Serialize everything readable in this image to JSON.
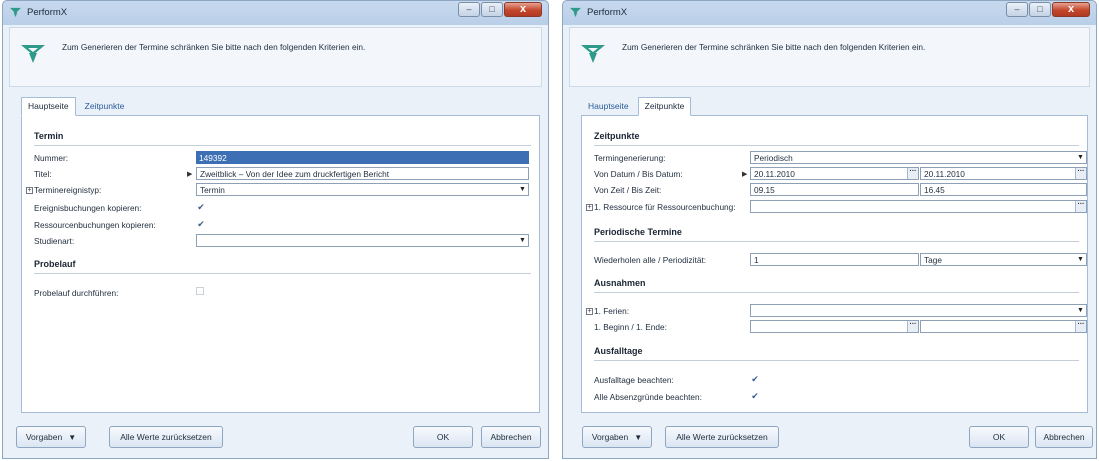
{
  "app": {
    "title": "PerformX",
    "header_text": "Zum Generieren der Termine schränken Sie bitte nach den folgenden Kriterien ein."
  },
  "window_controls": {
    "minimize": "–",
    "maximize": "□",
    "close": "x"
  },
  "tabs": {
    "main": "Hauptseite",
    "times": "Zeitpunkte"
  },
  "footer": {
    "presets": "Vorgaben",
    "reset_all": "Alle Werte zurücksetzen",
    "ok": "OK",
    "cancel": "Abbrechen"
  },
  "left": {
    "section_termin": "Termin",
    "nummer_label": "Nummer:",
    "nummer_value": "149392",
    "titel_label": "Titel:",
    "titel_value": "Zweitblick – Von der Idee zum druckfertigen Bericht",
    "terminereignistyp_label": "Terminereignistyp:",
    "terminereignistyp_value": "Termin",
    "ereignisbuchungen_label": "Ereignisbuchungen kopieren:",
    "ressourcenbuchungen_label": "Ressourcenbuchungen kopieren:",
    "studienart_label": "Studienart:",
    "studienart_value": "",
    "section_probelauf": "Probelauf",
    "probelauf_label": "Probelauf durchführen:"
  },
  "right": {
    "section_zeitpunkte": "Zeitpunkte",
    "termingenerierung_label": "Termingenerierung:",
    "termingenerierung_value": "Periodisch",
    "von_datum_label": "Von Datum / Bis Datum:",
    "von_datum_value": "20.11.2010",
    "bis_datum_value": "20.11.2010",
    "von_zeit_label": "Von Zeit / Bis Zeit:",
    "von_zeit_value": "09.15",
    "bis_zeit_value": "16.45",
    "ressource_label": "1. Ressource für Ressourcenbuchung:",
    "ressource_value": "",
    "section_periodische": "Periodische Termine",
    "wiederholen_label": "Wiederholen alle / Periodizität:",
    "wiederholen_value": "1",
    "periodizitaet_value": "Tage",
    "section_ausnahmen": "Ausnahmen",
    "ferien_label": "1. Ferien:",
    "ferien_value": "",
    "beginn_label": "1. Beginn / 1. Ende:",
    "beginn_value": "",
    "ende_value": "",
    "section_ausfalltage": "Ausfalltage",
    "ausfalltage_label": "Ausfalltage beachten:",
    "absenzgruende_label": "Alle Absenzgründe beachten:"
  },
  "checks": {
    "ereignisbuchungen": true,
    "ressourcenbuchungen": true,
    "probelauf": false,
    "ausfalltage": true,
    "absenzgruende": true
  }
}
